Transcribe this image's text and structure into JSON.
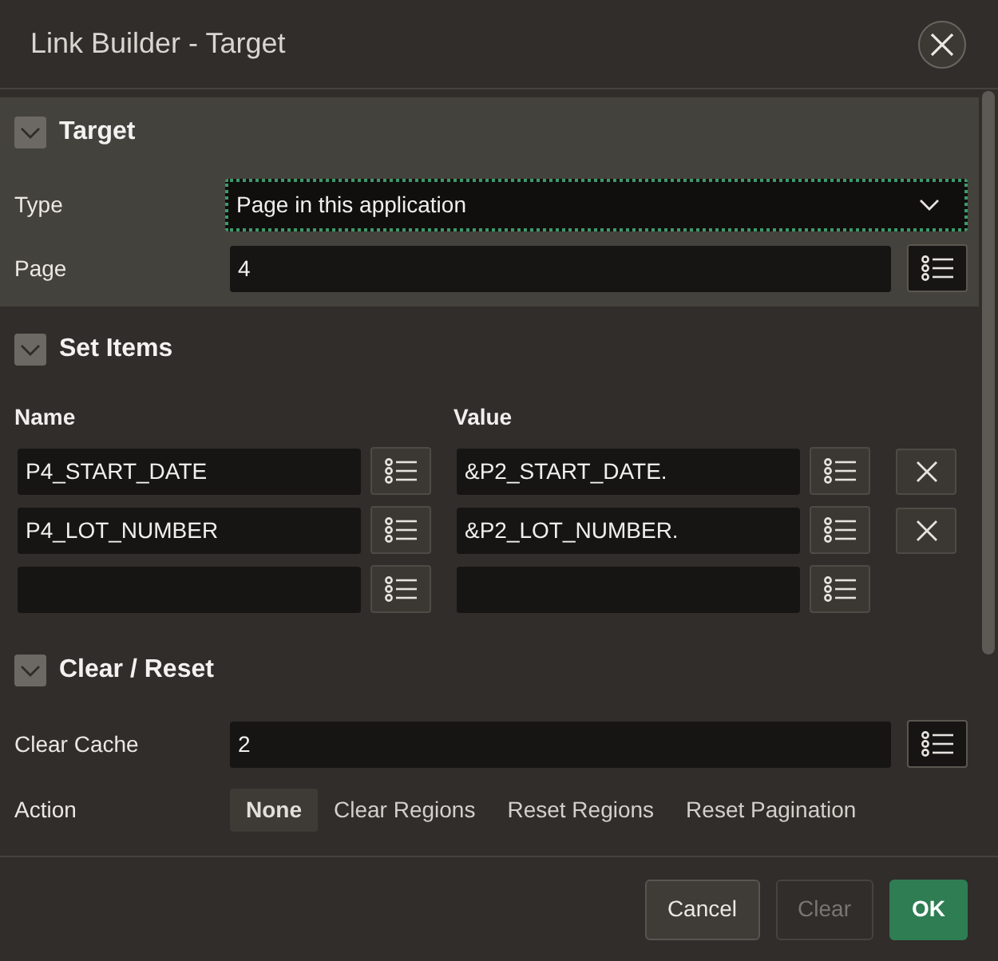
{
  "dialog": {
    "title": "Link Builder - Target"
  },
  "sections": [
    {
      "kind": "form",
      "title": "Target",
      "expanded": true,
      "highlighted": true,
      "fields": [
        {
          "kind": "select",
          "label": "Type",
          "value": "Page in this application",
          "focused": true
        },
        {
          "kind": "popup_lov",
          "label": "Page",
          "value": "4",
          "focused": false
        }
      ]
    },
    {
      "kind": "item_grid",
      "title": "Set Items",
      "expanded": true,
      "highlighted": false,
      "columns": [
        "Name",
        "Value"
      ],
      "rows": [
        {
          "name": "P4_START_DATE",
          "value": "&P2_START_DATE.",
          "removable": true
        },
        {
          "name": "P4_LOT_NUMBER",
          "value": "&P2_LOT_NUMBER.",
          "removable": true
        },
        {
          "removable": false
        }
      ]
    },
    {
      "kind": "form",
      "title": "Clear / Reset",
      "expanded": true,
      "highlighted": false,
      "fields": [
        {
          "kind": "popup_lov",
          "label": "Clear Cache",
          "value": "2",
          "focused": false
        },
        {
          "kind": "radio_group",
          "label": "Action",
          "options": [
            {
              "label": "None",
              "selected": true
            },
            {
              "label": "Clear Regions",
              "selected": false
            },
            {
              "label": "Reset Regions",
              "selected": false
            },
            {
              "label": "Reset Pagination",
              "selected": false
            }
          ]
        }
      ]
    }
  ],
  "buttons": [
    {
      "label": "Cancel",
      "kind": "default",
      "disabled": false
    },
    {
      "label": "Clear",
      "kind": "default",
      "disabled": true
    },
    {
      "label": "OK",
      "kind": "primary",
      "disabled": false
    }
  ]
}
